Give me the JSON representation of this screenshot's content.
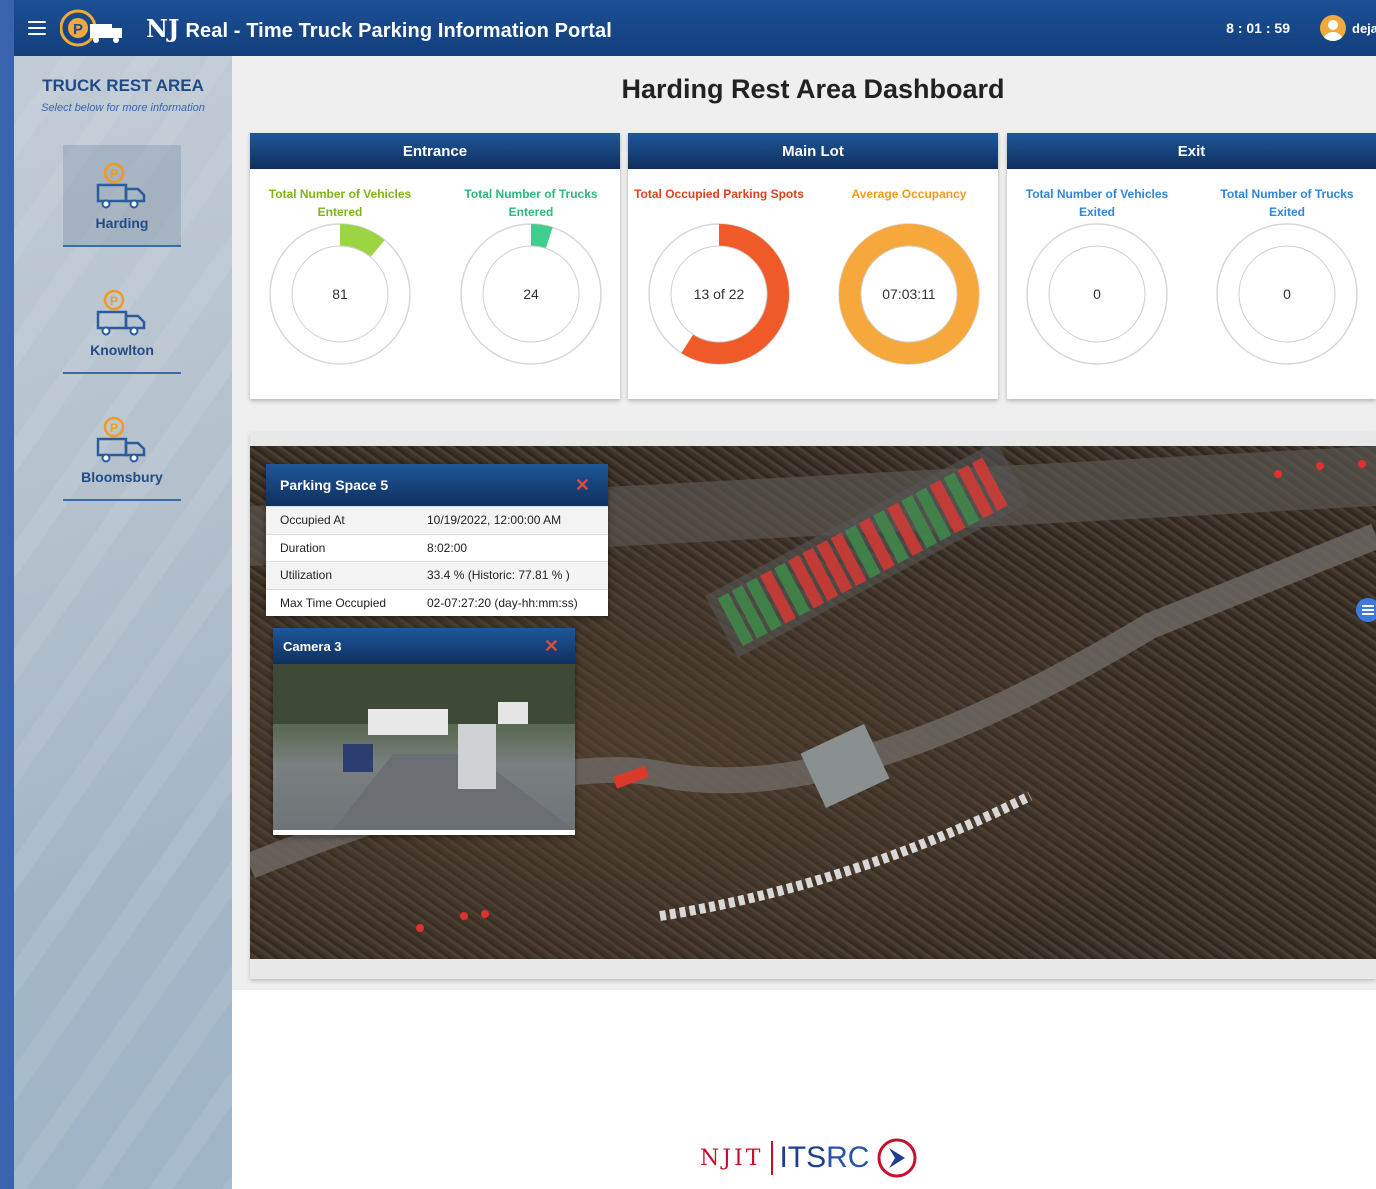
{
  "header": {
    "title_prefix": "NJ",
    "title": "Real - Time Truck Parking Information Portal",
    "clock": "8 : 01 : 59",
    "user": "deja"
  },
  "sidebar": {
    "title": "TRUCK REST AREA",
    "subtitle": "Select below for more information",
    "items": [
      {
        "label": "Harding",
        "active": true
      },
      {
        "label": "Knowlton",
        "active": false
      },
      {
        "label": "Bloomsbury",
        "active": false
      }
    ]
  },
  "page_title": "Harding Rest Area Dashboard",
  "panels": {
    "entrance": {
      "title": "Entrance",
      "gauges": [
        {
          "label": "Total Number of Vehicles Entered",
          "value": "81",
          "fraction": 0.11,
          "color": "#9bd544",
          "label_color": "#7cb518"
        },
        {
          "label": "Total Number of Trucks Entered",
          "value": "24",
          "fraction": 0.05,
          "color": "#3ecf8e",
          "label_color": "#2fb87a"
        }
      ]
    },
    "main_lot": {
      "title": "Main Lot",
      "gauges": [
        {
          "label": "Total Occupied Parking Spots",
          "value": "13 of 22",
          "fraction": 0.59,
          "color": "#f05a28",
          "label_color": "#e0401c"
        },
        {
          "label": "Average Occupancy",
          "value": "07:03:11",
          "fraction": 1.0,
          "color": "#f7a83c",
          "label_color": "#f29a1f"
        }
      ]
    },
    "exit": {
      "title": "Exit",
      "gauges": [
        {
          "label": "Total Number of Vehicles Exited",
          "value": "0",
          "fraction": 0,
          "color": "#3b8fe0",
          "label_color": "#2f86d9"
        },
        {
          "label": "Total Number of Trucks Exited",
          "value": "0",
          "fraction": 0,
          "color": "#3b8fe0",
          "label_color": "#2f86d9"
        }
      ]
    }
  },
  "parking_popup": {
    "title": "Parking Space 5",
    "rows": [
      {
        "key": "Occupied At",
        "value": "10/19/2022, 12:00:00 AM"
      },
      {
        "key": "Duration",
        "value": "8:02:00"
      },
      {
        "key": "Utilization",
        "value": "33.4 % (Historic: 77.81 % )"
      },
      {
        "key": "Max Time Occupied",
        "value": "02-07:27:20 (day-hh:mm:ss)"
      }
    ]
  },
  "camera_popup": {
    "title": "Camera 3"
  },
  "footer": {
    "njit": "NJIT",
    "its": "ITS",
    "rc": "RC"
  },
  "colors": {
    "header": "#1a4f95",
    "panel_head": "#1e5799",
    "accent_red": "#e6453c"
  }
}
